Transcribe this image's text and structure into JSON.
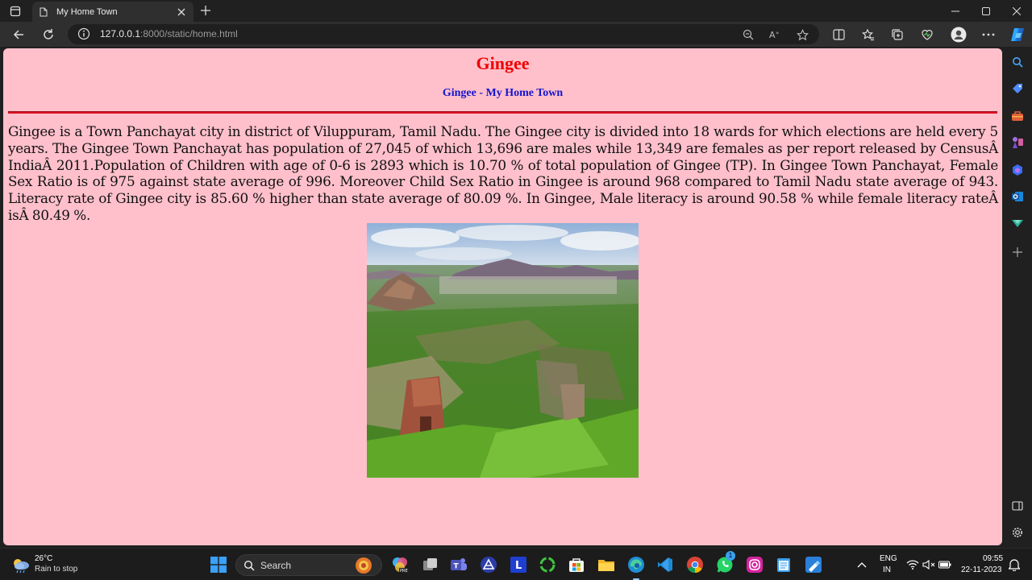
{
  "browser": {
    "tab_title": "My Home Town",
    "url_host": "127.0.0.1",
    "url_rest": ":8000/static/home.html"
  },
  "page": {
    "heading": "Gingee",
    "subheading": "Gingee - My Home Town",
    "paragraph": "Gingee is a Town Panchayat city in district of Viluppuram, Tamil Nadu. The Gingee city is divided into 18 wards for which elections are held every 5 years. The Gingee Town Panchayat has population of 27,045 of which 13,696 are males while 13,349 are females as per report released by CensusÂ IndiaÂ 2011.Population of Children with age of 0-6 is 2893 which is 10.70 % of total population of Gingee (TP). In Gingee Town Panchayat, Female Sex Ratio is of 975 against state average of 996. Moreover Child Sex Ratio in Gingee is around 968 compared to Tamil Nadu state average of 943. Literacy rate of Gingee city is 85.60 % higher than state average of 80.09 %. In Gingee, Male literacy is around 90.58 % while female literacy rateÂ isÂ 80.49 %."
  },
  "taskbar": {
    "temperature": "26°C",
    "weather": "Rain to stop",
    "search_label": "Search",
    "lang_1": "ENG",
    "lang_2": "IN",
    "time": "09:55",
    "date": "22-11-2023",
    "whatsapp_badge": "1"
  },
  "colors": {
    "page_background": "#ffc0cb",
    "heading": "#ee0000",
    "subheading": "#1414d0",
    "rule": "#dd1020"
  }
}
